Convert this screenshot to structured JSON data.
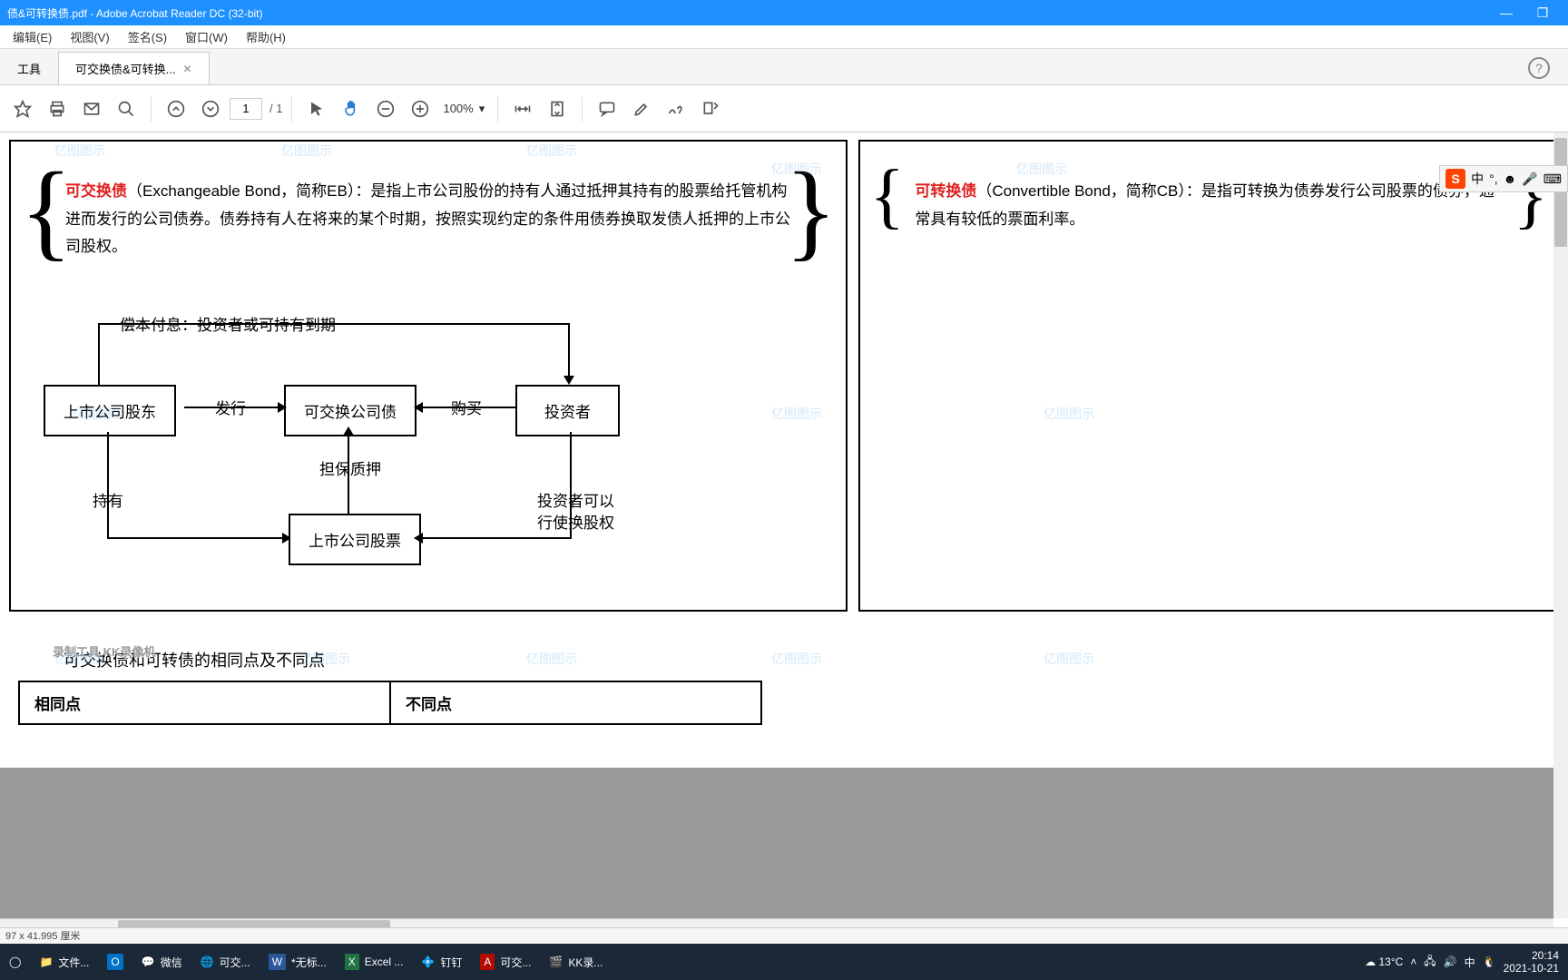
{
  "window": {
    "title": "债&可转换债.pdf - Adobe Acrobat Reader DC (32-bit)"
  },
  "menu": {
    "edit": "编辑(E)",
    "view": "视图(V)",
    "sign": "签名(S)",
    "window": "窗口(W)",
    "help": "帮助(H)"
  },
  "tabs": {
    "home": "工具",
    "doc": "可交换债&可转换..."
  },
  "toolbar": {
    "page_current": "1",
    "page_total": "/ 1",
    "zoom": "100%"
  },
  "doc": {
    "eb": {
      "term": "可交换债",
      "def": "（Exchangeable Bond，简称EB）：是指上市公司股份的持有人通过抵押其持有的股票给托管机构进而发行的公司债券。债券持有人在将来的某个时期，按照实现约定的条件用债券换取发债人抵押的上市公司股权。"
    },
    "cb": {
      "term": "可转换债",
      "def": "（Convertible Bond，简称CB）：是指可转换为债券发行公司股票的债券，通常具有较低的票面利率。"
    },
    "flow": {
      "top": "偿本付息：投资者或可持有到期",
      "box_shareholder": "上市公司股东",
      "box_bond": "可交换公司债",
      "box_investor": "投资者",
      "box_stock": "上市公司股票",
      "lbl_issue": "发行",
      "lbl_buy": "购买",
      "lbl_hold": "持有",
      "lbl_pledge": "担保质押",
      "lbl_right1": "投资者可以",
      "lbl_right2": "行使换股权"
    },
    "section2": "可交换债和可转债的相同点及不同点",
    "col_same": "相同点",
    "col_diff": "不同点"
  },
  "status": {
    "size": "97 x 41.995 厘米"
  },
  "ime": {
    "lang": "中"
  },
  "taskbar": {
    "files": "文件...",
    "wechat": "微信",
    "chrome": "可交...",
    "word": "*无标...",
    "excel": "Excel ...",
    "dingtalk": "钉钉",
    "pdf": "可交...",
    "kk": "KK录...",
    "weather": "13°C",
    "ime": "中",
    "time": "20:14",
    "date": "2021-10-21"
  },
  "watermark": "亿图图示",
  "recorder_overlay": "录制工具 KK录像机"
}
